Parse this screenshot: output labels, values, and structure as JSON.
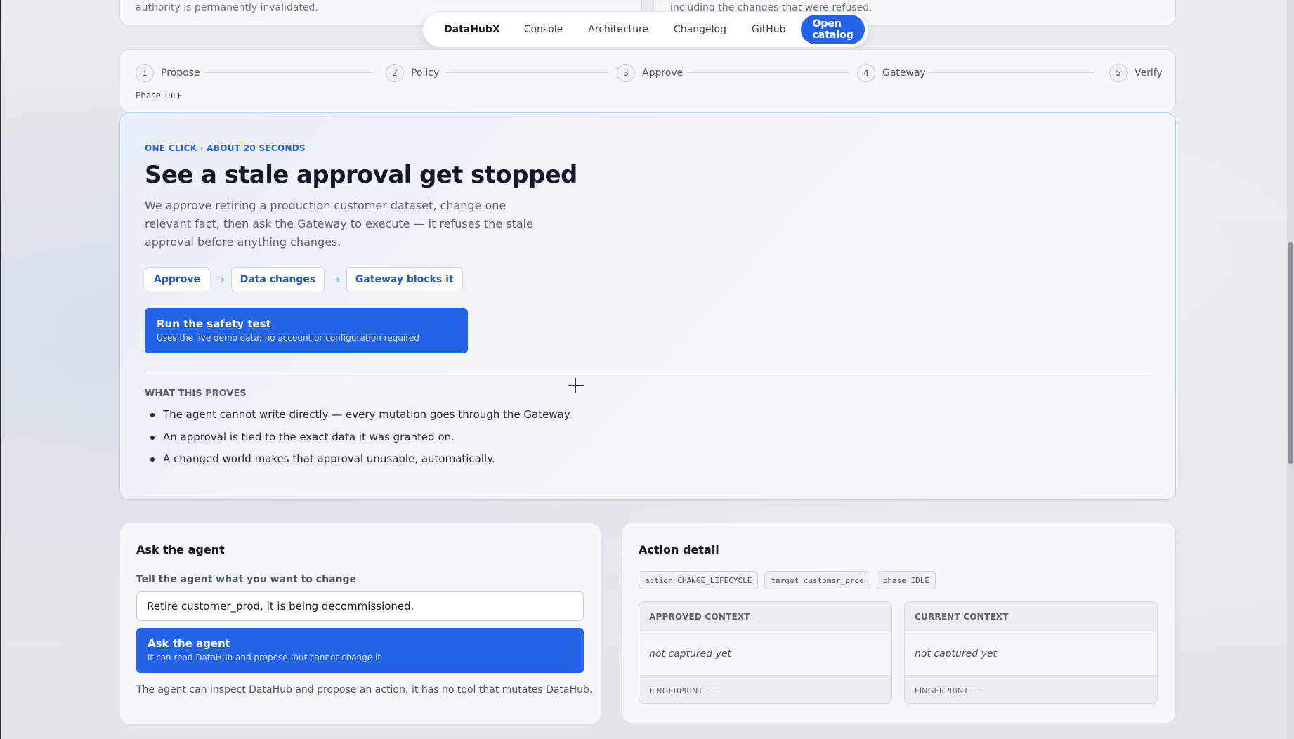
{
  "top_cards": {
    "left_snippet": "authority is permanently invalidated.",
    "right_snippet": "including the changes that were refused."
  },
  "nav": {
    "brand": "DataHubX",
    "links": [
      "Console",
      "Architecture",
      "Changelog",
      "GitHub"
    ],
    "cta": "Open catalog",
    "accent_color": "#2463e8"
  },
  "stepper": {
    "steps": [
      {
        "num": "1",
        "label": "Propose"
      },
      {
        "num": "2",
        "label": "Policy"
      },
      {
        "num": "3",
        "label": "Approve"
      },
      {
        "num": "4",
        "label": "Gateway"
      },
      {
        "num": "5",
        "label": "Verify"
      }
    ],
    "phase_label": "Phase",
    "phase_value": "IDLE"
  },
  "hero": {
    "eyebrow": "ONE CLICK · ABOUT 20 SECONDS",
    "title": "See a stale approval get stopped",
    "lede": "We approve retiring a production customer dataset, change one relevant fact, then ask the Gateway to execute — it refuses the stale approval before anything changes.",
    "chips": [
      "Approve",
      "Data changes",
      "Gateway blocks it"
    ],
    "run_button": {
      "title": "Run the safety test",
      "subtitle": "Uses the live demo data; no account or configuration required"
    },
    "proves_title": "WHAT THIS PROVES",
    "proves": [
      "The agent cannot write directly — every mutation goes through the Gateway.",
      "An approval is tied to the exact data it was granted on.",
      "A changed world makes that approval unusable, automatically."
    ]
  },
  "ask": {
    "title": "Ask the agent",
    "field_label": "Tell the agent what you want to change",
    "input_value": "Retire customer_prod, it is being decommissioned.",
    "button_title": "Ask the agent",
    "button_subtitle": "It can read DataHub and propose, but cannot change it",
    "footnote": "The agent can inspect DataHub and propose an action; it has no tool that mutates DataHub."
  },
  "detail": {
    "title": "Action detail",
    "tags": [
      "action CHANGE_LIFECYCLE",
      "target customer_prod",
      "phase IDLE"
    ],
    "approved": {
      "head": "APPROVED CONTEXT",
      "body": "not captured yet",
      "fp_label": "FINGERPRINT",
      "fp_value": "—"
    },
    "current": {
      "head": "CURRENT CONTEXT",
      "body": "not captured yet",
      "fp_label": "FINGERPRINT",
      "fp_value": "—"
    }
  }
}
